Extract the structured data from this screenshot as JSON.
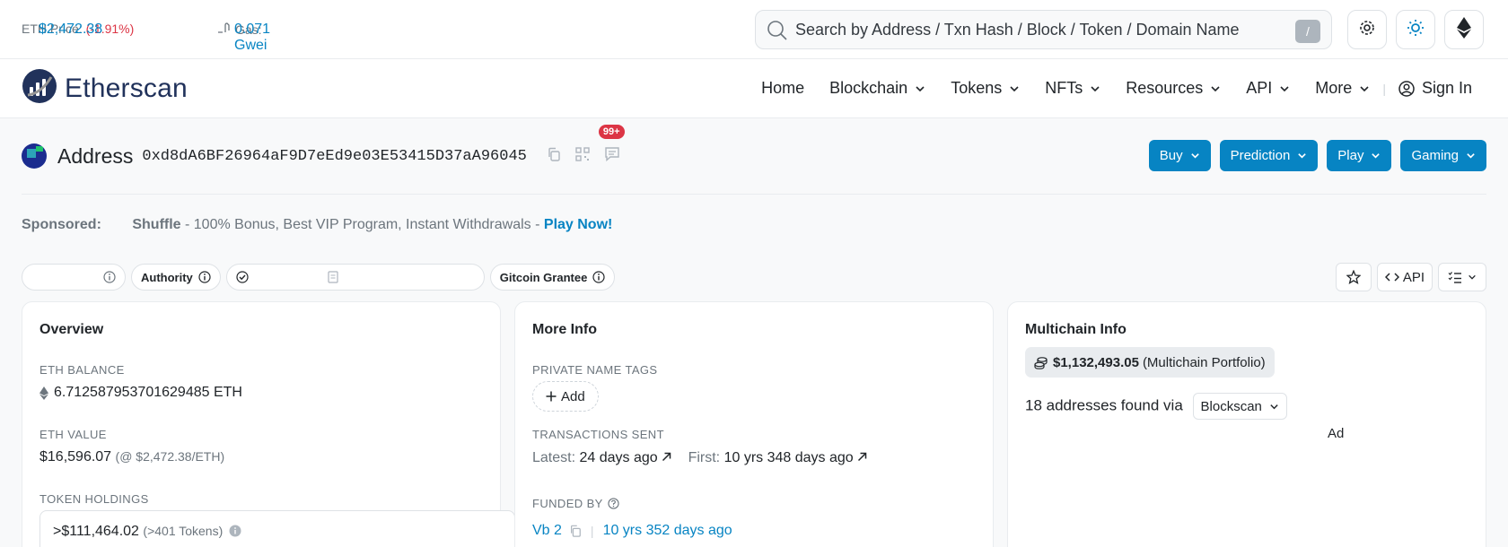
{
  "topbar": {
    "eth_price_label": "ETH Price:",
    "eth_price_value": "$2,472.38",
    "eth_price_change": "(-1.91%)",
    "gas_label": "Gas:",
    "gas_value": "0.071 Gwei",
    "search_placeholder": "Search by Address / Txn Hash / Block / Token / Domain Name",
    "search_shortcut": "/"
  },
  "header": {
    "brand": "Etherscan",
    "nav": {
      "home": "Home",
      "blockchain": "Blockchain",
      "tokens": "Tokens",
      "nfts": "NFTs",
      "resources": "Resources",
      "api": "API",
      "more": "More",
      "sign_in": "Sign In"
    }
  },
  "address": {
    "label": "Address",
    "hash": "0xd8dA6BF26964aF9D7eEd9e03E53415D37aA96045",
    "comments_badge": "99+",
    "actions": {
      "buy": "Buy",
      "prediction": "Prediction",
      "play": "Play",
      "gaming": "Gaming"
    }
  },
  "sponsored": {
    "label": "Sponsored:",
    "name": "Shuffle",
    "text": " - 100% Bonus, Best VIP Program, Instant Withdrawals - ",
    "cta": "Play Now!"
  },
  "tags": {
    "authority": "Authority",
    "gitcoin": "Gitcoin Grantee",
    "api_button": "API"
  },
  "overview": {
    "title": "Overview",
    "eth_balance_label": "ETH BALANCE",
    "eth_balance_value": "6.712587953701629485 ETH",
    "eth_value_label": "ETH VALUE",
    "eth_value_amount": "$16,596.07",
    "eth_value_rate": "(@ $2,472.38/ETH)",
    "token_holdings_label": "TOKEN HOLDINGS",
    "token_holdings_value": ">$111,464.02",
    "token_holdings_count": "(>401 Tokens)"
  },
  "more_info": {
    "title": "More Info",
    "private_tags_label": "PRIVATE NAME TAGS",
    "add_button": "Add",
    "tx_sent_label": "TRANSACTIONS SENT",
    "latest_label": "Latest:",
    "latest_value": "24 days ago",
    "first_label": "First:",
    "first_value": "10 yrs 348 days ago",
    "funded_by_label": "FUNDED BY",
    "funded_by_name": "Vb 2",
    "funded_by_age": "10 yrs 352 days ago"
  },
  "multichain": {
    "title": "Multichain Info",
    "portfolio_value": "$1,132,493.05",
    "portfolio_label": "(Multichain Portfolio)",
    "addresses_text": "18 addresses found via",
    "via_select": "Blockscan",
    "ad_label": "Ad"
  }
}
